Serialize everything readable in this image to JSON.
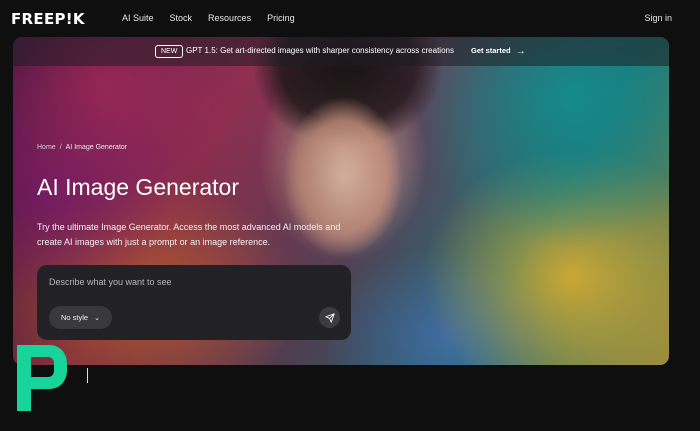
{
  "brand": {
    "logo_text": "FREEP!K",
    "accent_color": "#16d49a"
  },
  "nav": {
    "links": [
      "AI Suite",
      "Stock",
      "Resources",
      "Pricing"
    ],
    "signin": "Sign in"
  },
  "announcement": {
    "badge": "NEW",
    "text": "GPT 1.5: Get art-directed images with sharper consistency across creations",
    "cta": "Get started",
    "cta_icon": "arrow-right-icon"
  },
  "hero": {
    "breadcrumb": {
      "home": "Home",
      "separator": "/",
      "current": "AI Image Generator"
    },
    "title": "AI Image Generator",
    "description": "Try the ultimate Image Generator. Access the most advanced AI models and create AI images with just a prompt or an image reference."
  },
  "prompt": {
    "placeholder": "Describe what you want to see",
    "value": "",
    "style_button": "No style",
    "style_icon": "chevron-down-icon",
    "send_icon": "send-icon"
  }
}
